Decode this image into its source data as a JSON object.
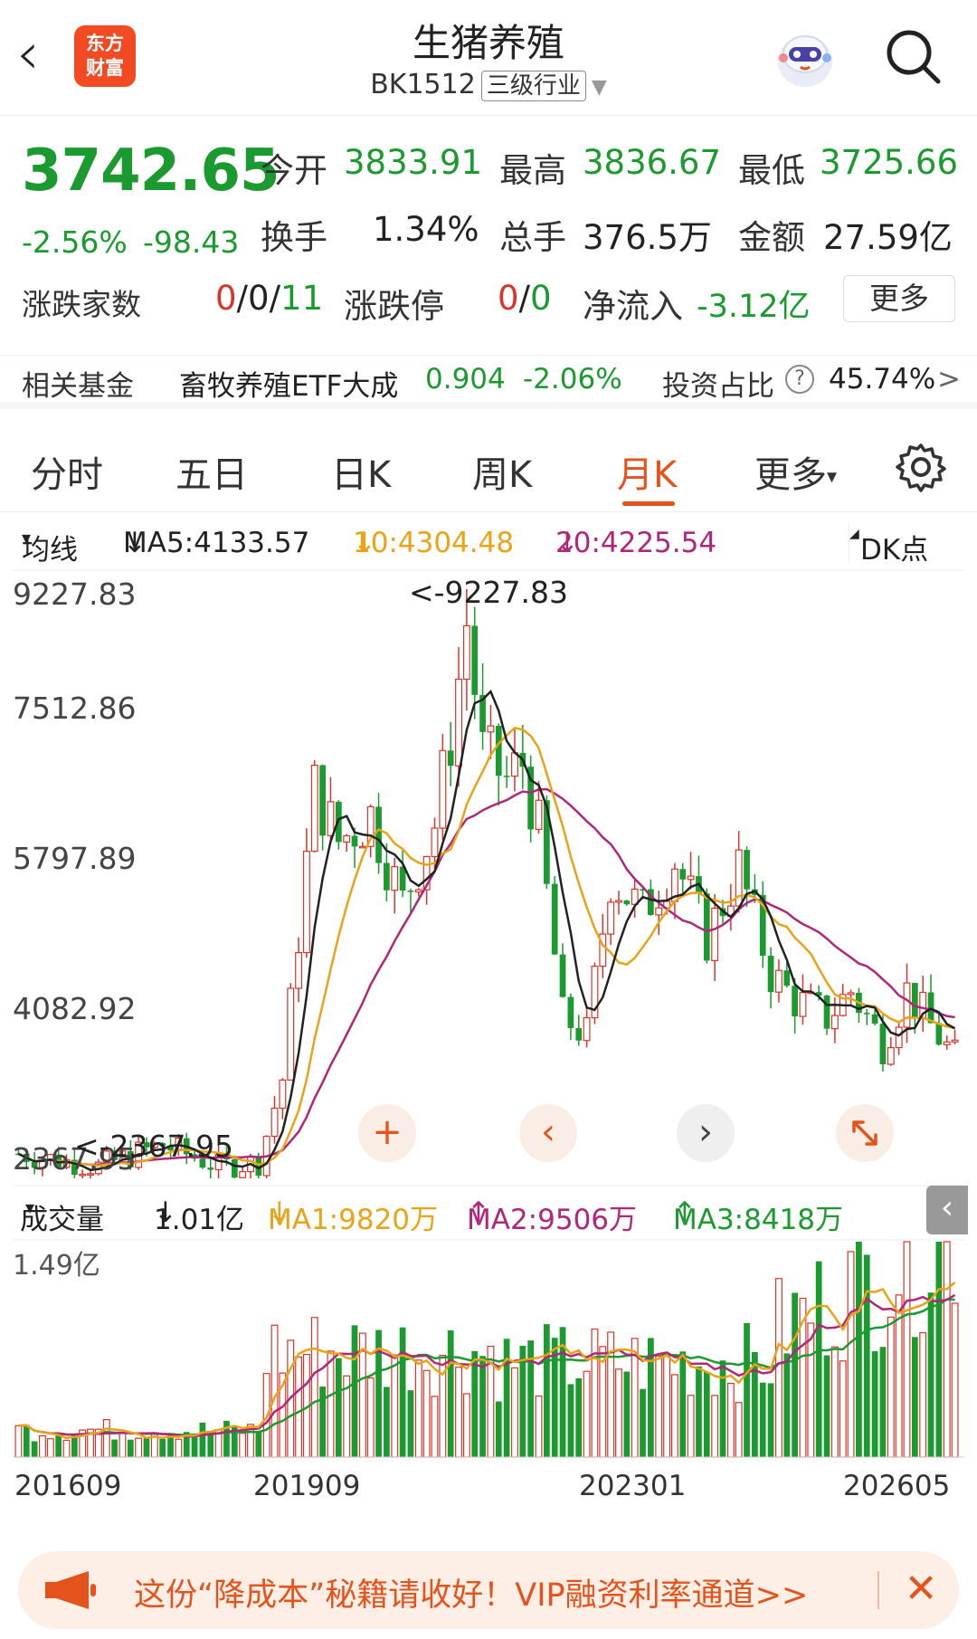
{
  "header": {
    "back_glyph": "‹",
    "logo_line1": "东方",
    "logo_line2": "财富",
    "title": "生猪养殖",
    "code": "BK1512",
    "level_tag": "三级行业",
    "caret": "▼"
  },
  "quote": {
    "price": "3742.65",
    "change_pct": "-2.56%",
    "change_amt": "-98.43",
    "open_label": "今开",
    "open": "3833.91",
    "high_label": "最高",
    "high": "3836.67",
    "low_label": "最低",
    "low": "3725.66",
    "turnover_label": "换手",
    "turnover": "1.34%",
    "volume_label": "总手",
    "volume": "376.5万",
    "amount_label": "金额",
    "amount": "27.59亿"
  },
  "stats": {
    "breadth_label": "涨跌家数",
    "breadth_up": "0",
    "breadth_sep1": "/",
    "breadth_flat": "0",
    "breadth_sep2": "/",
    "breadth_down": "11",
    "limit_label": "涨跌停",
    "limit_up": "0",
    "limit_sep": "/",
    "limit_down": "0",
    "netflow_label": "净流入",
    "netflow": "-3.12亿",
    "more_label": "更多"
  },
  "fund": {
    "label": "相关基金",
    "name": "畜牧养殖ETF大成",
    "price": "0.904",
    "change": "-2.06%",
    "ratio_label": "投资占比",
    "ratio_help": "?",
    "ratio": "45.74%",
    "arrow": ">"
  },
  "tabs": {
    "items": [
      "分时",
      "五日",
      "日K",
      "周K",
      "月K",
      "更多"
    ],
    "active": "月K",
    "more_caret": "▾"
  },
  "ma": {
    "selector": "均线",
    "selector_caret": "▾",
    "ma5": "MA5:4133.57",
    "ma5_arrow": "↓",
    "ma10": "10:4304.48",
    "ma10_arrow": "↓",
    "ma20": "20:4225.54",
    "ma20_arrow": "↓",
    "dk_label": "DK点"
  },
  "kline": {
    "y_labels": [
      "9227.83",
      "7512.86",
      "5797.89",
      "4082.92",
      "2367.95"
    ],
    "max_annotation": "<-9227.83",
    "min_annotation": "<-2367.95"
  },
  "volume": {
    "selector": "成交量",
    "selector_caret": "▾",
    "value": "1.01亿",
    "value_arrow": "↓",
    "ma1": "MA1:9820万",
    "ma1_arrow": "↓",
    "ma2": "MA2:9506万",
    "ma2_arrow": "↑",
    "ma3": "MA3:8418万",
    "ma3_arrow": "↑",
    "y_label": "1.49亿"
  },
  "dates": [
    "201609",
    "201909",
    "202301",
    "202605"
  ],
  "banner": {
    "text": "这份“降成本”秘籍请收好！VIP融资利率通道>>",
    "close": "✕"
  },
  "colors": {
    "up": "#d9342b",
    "down": "#1a9a2f",
    "accent": "#e5531c",
    "ma_fast": "#222222",
    "ma_mid": "#e8a317",
    "ma_slow": "#b0267a"
  }
}
